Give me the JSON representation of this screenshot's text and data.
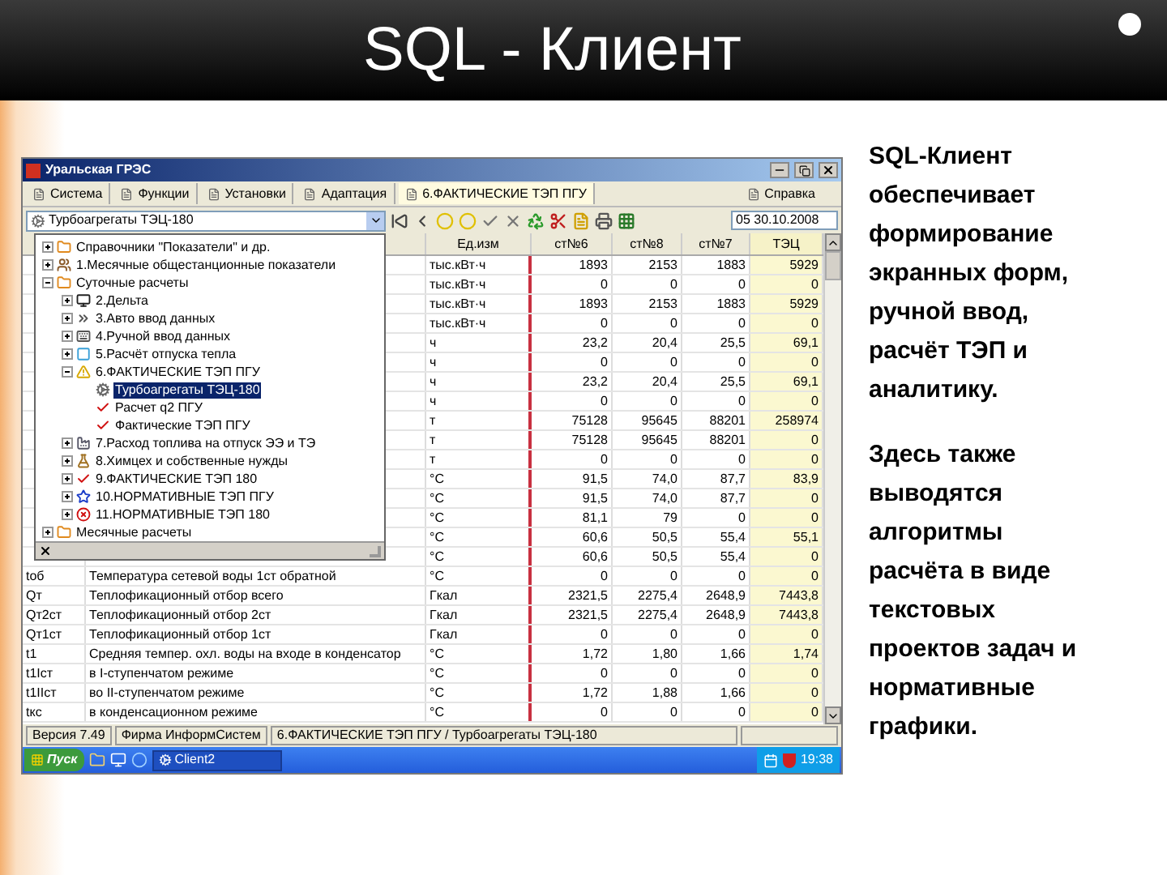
{
  "slide": {
    "title": "SQL - Клиент",
    "paragraphs": [
      "SQL-Клиент обеспечивает формирование экранных форм, ручной ввод, расчёт ТЭП и аналитику.",
      "Здесь также выводятся алгоритмы расчёта в виде текстовых проектов задач и нормативные графики."
    ]
  },
  "window": {
    "title": "Уральская ГРЭС",
    "menu": [
      {
        "label": "Система",
        "selected": false
      },
      {
        "label": "Функции",
        "selected": false
      },
      {
        "label": "Установки",
        "selected": false
      },
      {
        "label": "Адаптация",
        "selected": false
      },
      {
        "label": "6.ФАКТИЧЕСКИЕ ТЭП ПГУ",
        "selected": true
      }
    ],
    "help_menu": "Справка",
    "combobox": {
      "value": "Турбоагрегаты ТЭЦ-180"
    },
    "date_field": {
      "value": "05 30.10.2008"
    },
    "tree": [
      {
        "label": "Справочники \"Показатели\" и др.",
        "kind": "folder",
        "expanded": false,
        "selected": false
      },
      {
        "label": "1.Месячные общестанционные показатели",
        "kind": "people",
        "expanded": false,
        "selected": false
      },
      {
        "label": "Суточные расчеты",
        "kind": "folder",
        "expanded": true,
        "selected": false,
        "children": [
          {
            "label": "2.Дельта",
            "kind": "monitor",
            "expanded": false,
            "selected": false
          },
          {
            "label": "3.Авто ввод данных",
            "kind": "arrows",
            "expanded": false,
            "selected": false
          },
          {
            "label": "4.Ручной ввод данных",
            "kind": "keyboard",
            "expanded": false,
            "selected": false
          },
          {
            "label": "5.Расчёт отпуска тепла",
            "kind": "square",
            "expanded": false,
            "selected": false
          },
          {
            "label": "6.ФАКТИЧЕСКИЕ ТЭП ПГУ",
            "kind": "warning",
            "expanded": true,
            "selected": false,
            "children": [
              {
                "label": "Турбоагрегаты ТЭЦ-180",
                "kind": "gear",
                "selected": true
              },
              {
                "label": "Расчет q2 ПГУ",
                "kind": "check",
                "selected": false
              },
              {
                "label": "Фактические ТЭП ПГУ",
                "kind": "check",
                "selected": false
              }
            ]
          },
          {
            "label": "7.Расход топлива на отпуск ЭЭ и ТЭ",
            "kind": "factory",
            "expanded": false,
            "selected": false
          },
          {
            "label": "8.Химцех и собственные нужды",
            "kind": "flask",
            "expanded": false,
            "selected": false
          },
          {
            "label": "9.ФАКТИЧЕСКИЕ ТЭП 180",
            "kind": "check",
            "expanded": false,
            "selected": false
          },
          {
            "label": "10.НОРМАТИВНЫЕ ТЭП ПГУ",
            "kind": "star",
            "expanded": false,
            "selected": false
          },
          {
            "label": "11.НОРМАТИВНЫЕ ТЭП 180",
            "kind": "error",
            "expanded": false,
            "selected": false
          }
        ]
      },
      {
        "label": "Месячные расчеты",
        "kind": "folder",
        "expanded": false,
        "selected": false
      }
    ],
    "table": {
      "columns": [
        {
          "label": "Ед.изм",
          "highlighted": false
        },
        {
          "label": "ст№6",
          "highlighted": false
        },
        {
          "label": "ст№8",
          "highlighted": false
        },
        {
          "label": "ст№7",
          "highlighted": false
        },
        {
          "label": "ТЭЦ",
          "highlighted": true
        }
      ],
      "rows": [
        {
          "unit": "тыс.кВт·ч",
          "values": [
            "1893",
            "2153",
            "1883",
            "5929"
          ]
        },
        {
          "unit": "тыс.кВт·ч",
          "values": [
            "0",
            "0",
            "0",
            "0"
          ]
        },
        {
          "unit": "тыс.кВт·ч",
          "values": [
            "1893",
            "2153",
            "1883",
            "5929"
          ]
        },
        {
          "unit": "тыс.кВт·ч",
          "values": [
            "0",
            "0",
            "0",
            "0"
          ]
        },
        {
          "unit": "ч",
          "values": [
            "23,2",
            "20,4",
            "25,5",
            "69,1"
          ]
        },
        {
          "unit": "ч",
          "values": [
            "0",
            "0",
            "0",
            "0"
          ]
        },
        {
          "unit": "ч",
          "values": [
            "23,2",
            "20,4",
            "25,5",
            "69,1"
          ]
        },
        {
          "unit": "ч",
          "values": [
            "0",
            "0",
            "0",
            "0"
          ]
        },
        {
          "unit": "т",
          "values": [
            "75128",
            "95645",
            "88201",
            "258974"
          ]
        },
        {
          "unit": "т",
          "values": [
            "75128",
            "95645",
            "88201",
            "0"
          ]
        },
        {
          "unit": "т",
          "values": [
            "0",
            "0",
            "0",
            "0"
          ]
        },
        {
          "unit": "°C",
          "values": [
            "91,5",
            "74,0",
            "87,7",
            "83,9"
          ]
        },
        {
          "unit": "°C",
          "values": [
            "91,5",
            "74,0",
            "87,7",
            "0"
          ]
        },
        {
          "unit": "°C",
          "values": [
            "81,1",
            "79",
            "0",
            "0"
          ]
        },
        {
          "unit": "°C",
          "values": [
            "60,6",
            "50,5",
            "55,4",
            "55,1"
          ]
        },
        {
          "unit": "°C",
          "values": [
            "60,6",
            "50,5",
            "55,4",
            "0"
          ]
        },
        {
          "symbol": "tоб",
          "name": "Температура сетевой воды 1ст обратной",
          "unit": "°C",
          "values": [
            "0",
            "0",
            "0",
            "0"
          ]
        },
        {
          "symbol": "Qт",
          "name": "Теплофикационный отбор всего",
          "unit": "Гкал",
          "values": [
            "2321,5",
            "2275,4",
            "2648,9",
            "7443,8"
          ]
        },
        {
          "symbol": "Qт2ст",
          "name": "Теплофикационный отбор 2ст",
          "unit": "Гкал",
          "values": [
            "2321,5",
            "2275,4",
            "2648,9",
            "7443,8"
          ]
        },
        {
          "symbol": "Qт1ст",
          "name": "Теплофикационный отбор 1ст",
          "unit": "Гкал",
          "values": [
            "0",
            "0",
            "0",
            "0"
          ]
        },
        {
          "symbol": "t1",
          "name": "Средняя темпер. охл. воды на входе в конденсатор",
          "unit": "°C",
          "values": [
            "1,72",
            "1,80",
            "1,66",
            "1,74"
          ]
        },
        {
          "symbol": "t1Iст",
          "name": "в I-ступенчатом режиме",
          "unit": "°C",
          "values": [
            "0",
            "0",
            "0",
            "0"
          ]
        },
        {
          "symbol": "t1IIст",
          "name": "во II-ступенчатом режиме",
          "unit": "°C",
          "values": [
            "1,72",
            "1,88",
            "1,66",
            "0"
          ]
        },
        {
          "symbol": "tкс",
          "name": "в конденсационном режиме",
          "unit": "°C",
          "values": [
            "0",
            "0",
            "0",
            "0"
          ]
        }
      ]
    },
    "status_bar": [
      "Версия 7.49",
      "Фирма ИнформСистем",
      "6.ФАКТИЧЕСКИЕ ТЭП ПГУ / Турбоагрегаты ТЭЦ-180"
    ],
    "taskbar": {
      "start": "Пуск",
      "task": "Client2",
      "clock": "19:38"
    }
  }
}
